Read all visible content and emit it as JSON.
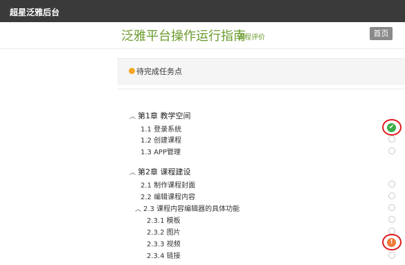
{
  "topbar": {
    "title": "超星泛雅后台"
  },
  "header": {
    "main_title": "泛雅平台操作运行指南",
    "subtitle": "课程评价",
    "home_button": "首页"
  },
  "tasks": {
    "label": "待完成任务点"
  },
  "toc": {
    "chapter1": {
      "label": "第1章 教学空间"
    },
    "item_1_1": {
      "label": "1.1 登录系统"
    },
    "item_1_2": {
      "label": "1.2 创建课程"
    },
    "item_1_3": {
      "label": "1.3 APP管理"
    },
    "chapter2": {
      "label": "第2章 课程建设"
    },
    "item_2_1": {
      "label": "2.1 制作课程封面"
    },
    "item_2_2": {
      "label": "2.2 编辑课程内容"
    },
    "item_2_3": {
      "label": "2.3 课程内容编辑器的具体功能"
    },
    "item_2_3_1": {
      "label": "2.3.1 模板"
    },
    "item_2_3_2": {
      "label": "2.3.2 图片"
    },
    "item_2_3_3": {
      "label": "2.3.3 视频"
    },
    "item_2_3_4": {
      "label": "2.3.4 链接"
    }
  },
  "icons": {
    "done": "check-circle-icon",
    "warning": "exclamation-circle-icon",
    "pending": "empty-circle-icon"
  },
  "colors": {
    "accent_green": "#6b9a2d",
    "done_green": "#3bae4a",
    "warning_orange": "#ee7a3a",
    "highlight_red": "#e0191b"
  }
}
